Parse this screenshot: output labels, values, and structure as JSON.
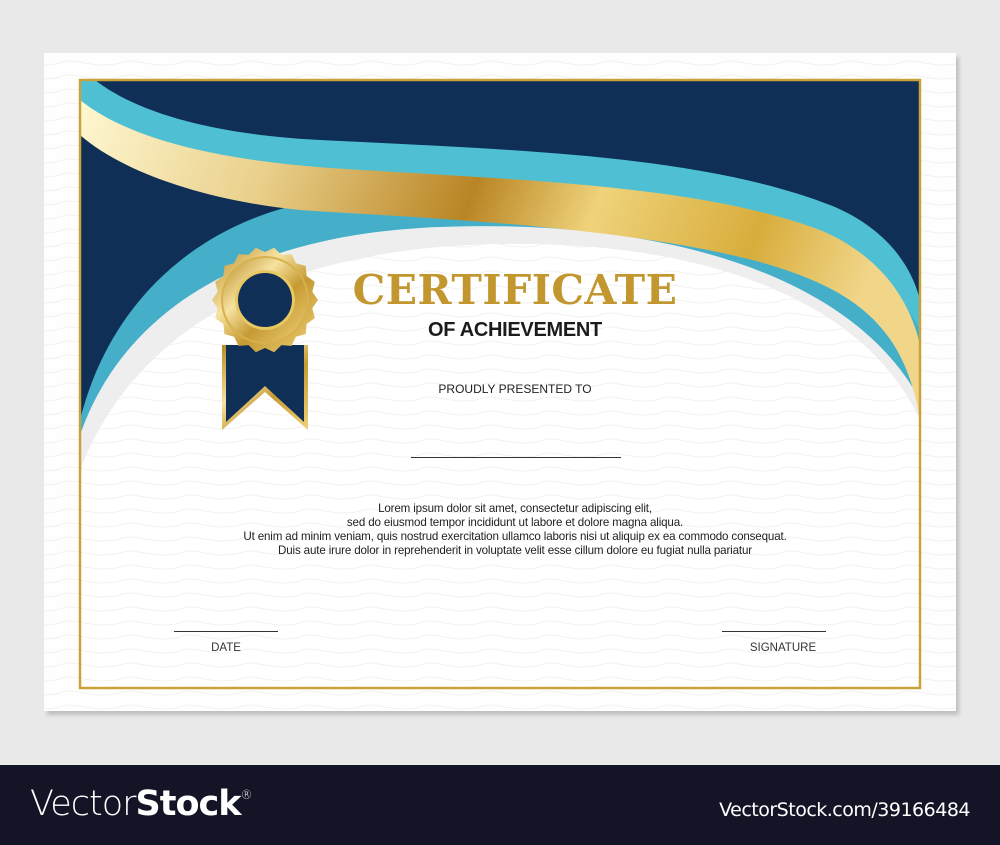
{
  "certificate": {
    "title": "CERTIFICATE",
    "subtitle": "OF ACHIEVEMENT",
    "presented_label": "PROUDLY PRESENTED TO",
    "body_lines": [
      "Lorem ipsum dolor sit amet, consectetur adipiscing elit,",
      "sed do eiusmod tempor incididunt ut labore et dolore magna aliqua.",
      "Ut enim ad minim veniam, quis nostrud exercitation ullamco laboris nisi ut aliquip ex ea commodo consequat.",
      "Duis aute irure dolor in reprehenderit in voluptate velit esse cillum dolore eu fugiat nulla pariatur"
    ],
    "date_label": "DATE",
    "signature_label": "SIGNATURE",
    "colors": {
      "navy": "#0f2f57",
      "cyan": "#4fc0d4",
      "gold": "#c2972f",
      "border": "#c9a23a"
    }
  },
  "footer": {
    "logo_light": "Vector",
    "logo_bold": "Stock",
    "logo_mark": "®",
    "url": "VectorStock.com/39166484"
  }
}
